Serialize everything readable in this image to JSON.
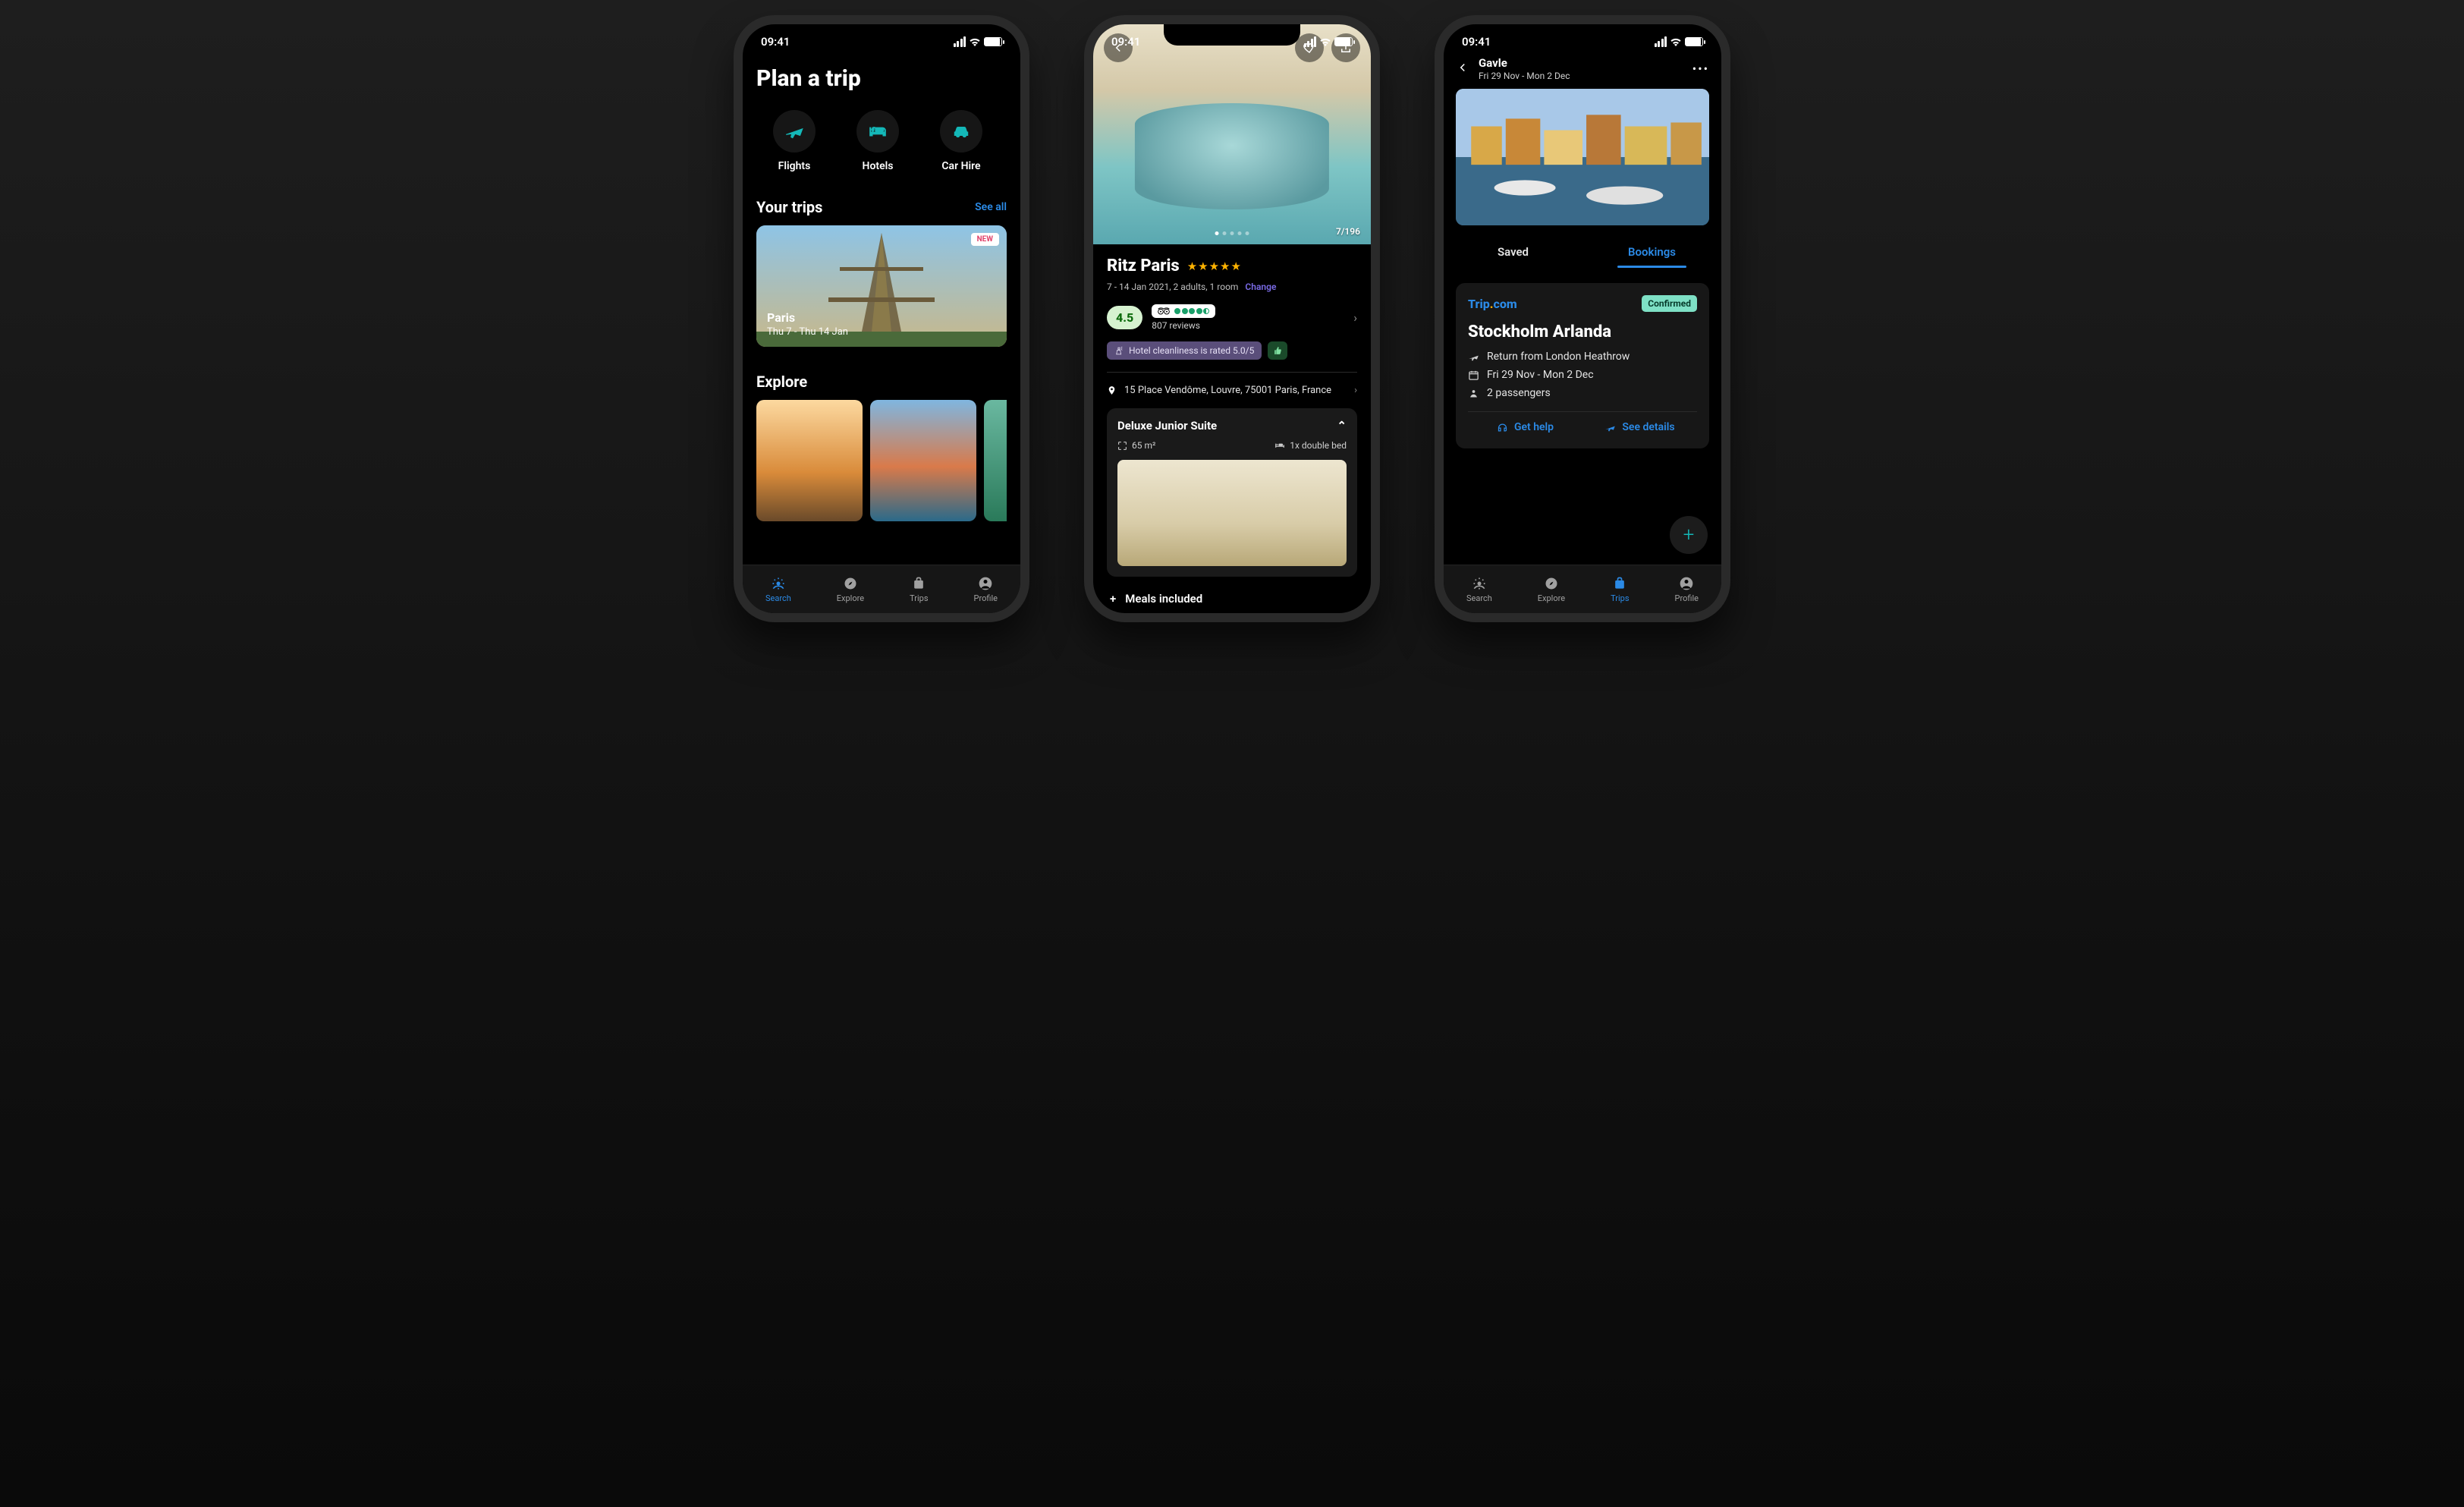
{
  "status": {
    "time": "09:41"
  },
  "nav": {
    "search": "Search",
    "explore": "Explore",
    "trips": "Trips",
    "profile": "Profile"
  },
  "screen1": {
    "title": "Plan a trip",
    "cats": {
      "flights": "Flights",
      "hotels": "Hotels",
      "carhire": "Car Hire"
    },
    "yourTrips": {
      "heading": "Your trips",
      "seeAll": "See all"
    },
    "trip": {
      "badge": "NEW",
      "city": "Paris",
      "dates": "Thu 7 - Thu 14 Jan"
    },
    "explore": {
      "heading": "Explore"
    }
  },
  "screen2": {
    "imageCounter": "7/196",
    "hotelName": "Ritz Paris",
    "dateGuests": "7 - 14 Jan 2021, 2 adults, 1 room",
    "change": "Change",
    "score": "4.5",
    "reviewCount": "807 reviews",
    "cleanliness": "Hotel cleanliness is rated 5.0/5",
    "address": "15 Place Vendôme, Louvre, 75001 Paris, France",
    "room": {
      "name": "Deluxe Junior Suite",
      "area": "65 m²",
      "bed": "1x double bed"
    },
    "meals": "Meals included"
  },
  "screen3": {
    "header": {
      "city": "Gavle",
      "dates": "Fri 29 Nov - Mon 2 Dec"
    },
    "tabs": {
      "saved": "Saved",
      "bookings": "Bookings"
    },
    "booking": {
      "provider": "Trip",
      "providerSuffix": "com",
      "status": "Confirmed",
      "title": "Stockholm Arlanda",
      "route": "Return from London Heathrow",
      "dates": "Fri 29 Nov - Mon 2 Dec",
      "pax": "2 passengers",
      "getHelp": "Get help",
      "seeDetails": "See details"
    }
  }
}
